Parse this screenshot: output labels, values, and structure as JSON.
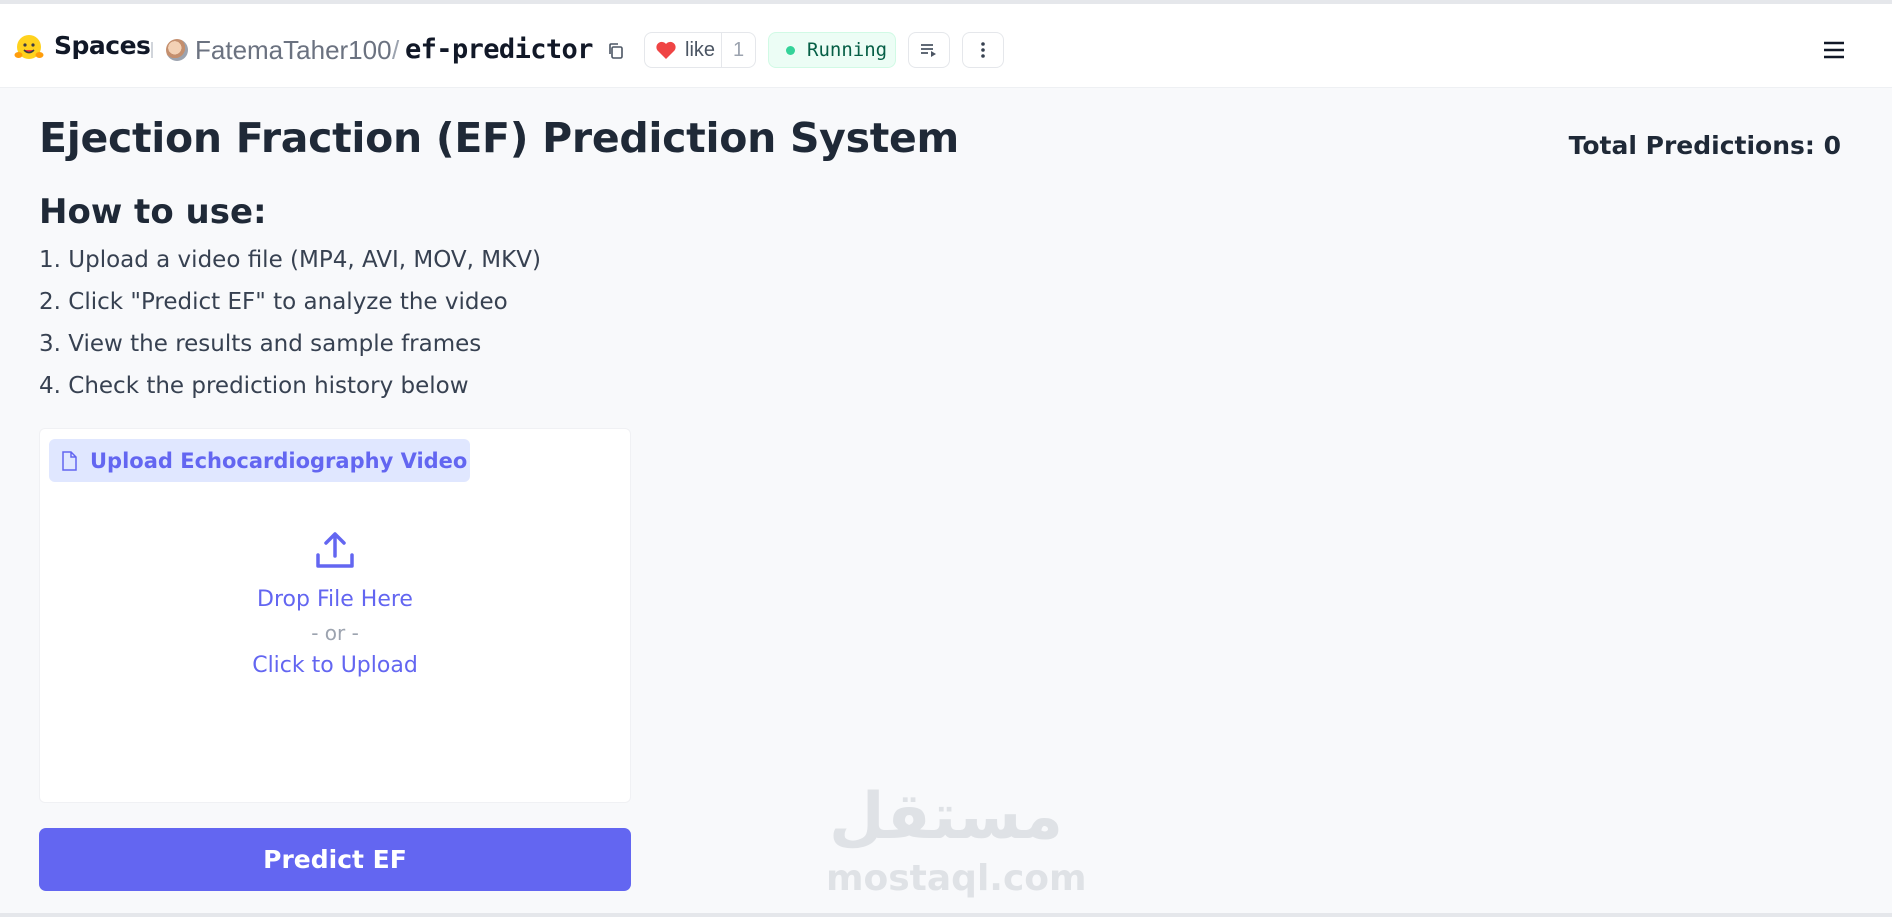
{
  "header": {
    "spaces_label": "Spaces",
    "owner": "FatemaTaher100",
    "separator": "/",
    "repo": "ef-predictor",
    "like_label": "like",
    "like_count": "1",
    "status": "Running",
    "icons": [
      "hugging-face-logo",
      "copy-icon",
      "heart-icon",
      "logs-icon",
      "more-icon",
      "menu-icon"
    ]
  },
  "main": {
    "title": "Ejection Fraction (EF) Prediction System",
    "total_predictions": "Total Predictions: 0",
    "howto_heading": "How to use:",
    "steps": [
      "1. Upload a video file (MP4, AVI, MOV, MKV)",
      "2. Click \"Predict EF\" to analyze the video",
      "3. View the results and sample frames",
      "4. Check the prediction history below"
    ]
  },
  "upload": {
    "label": "Upload Echocardiography Video",
    "drop_text": "Drop File Here",
    "or_text": "- or -",
    "click_text": "Click to Upload"
  },
  "predict_button": "Predict EF",
  "watermark": {
    "arabic": "مستقل",
    "latin": "mostaql.com"
  },
  "colors": {
    "accent": "#6366f1",
    "status_bg": "#ecfdf5",
    "status_dot": "#34d399",
    "heart": "#ef4444"
  }
}
